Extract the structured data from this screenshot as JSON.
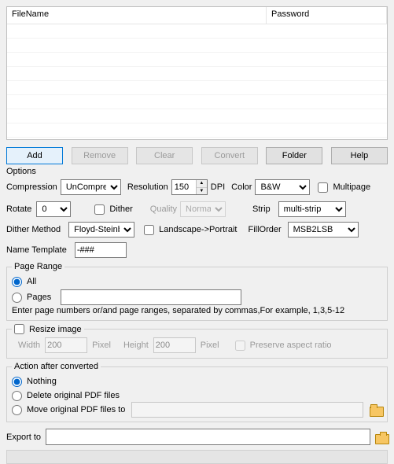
{
  "table": {
    "col_filename": "FileName",
    "col_password": "Password"
  },
  "buttons": {
    "add": "Add",
    "remove": "Remove",
    "clear": "Clear",
    "convert": "Convert",
    "folder": "Folder",
    "help": "Help"
  },
  "options_label": "Options",
  "compression": {
    "label": "Compression",
    "value": "UnCompress"
  },
  "resolution": {
    "label": "Resolution",
    "value": "150",
    "unit": "DPI"
  },
  "color": {
    "label": "Color",
    "value": "B&W"
  },
  "multipage": {
    "label": "Multipage"
  },
  "rotate": {
    "label": "Rotate",
    "value": "0"
  },
  "dither": {
    "label": "Dither"
  },
  "quality": {
    "label": "Quality",
    "value": "Normal"
  },
  "strip": {
    "label": "Strip",
    "value": "multi-strip"
  },
  "dither_method": {
    "label": "Dither Method",
    "value": "Floyd-Steinb"
  },
  "landscape_portrait": {
    "label": "Landscape->Portrait"
  },
  "fillorder": {
    "label": "FillOrder",
    "value": "MSB2LSB"
  },
  "name_template": {
    "label": "Name Template",
    "value": "-###"
  },
  "page_range": {
    "legend": "Page Range",
    "all": "All",
    "pages": "Pages",
    "hint": "Enter page numbers or/and page ranges, separated by commas,For example, 1,3,5-12"
  },
  "resize": {
    "label": "Resize image",
    "width_label": "Width",
    "width_value": "200",
    "pixel": "Pixel",
    "height_label": "Height",
    "height_value": "200",
    "preserve": "Preserve aspect ratio"
  },
  "action": {
    "legend": "Action after converted",
    "nothing": "Nothing",
    "delete": "Delete original PDF files",
    "move": "Move original PDF files to"
  },
  "export_to": "Export to"
}
